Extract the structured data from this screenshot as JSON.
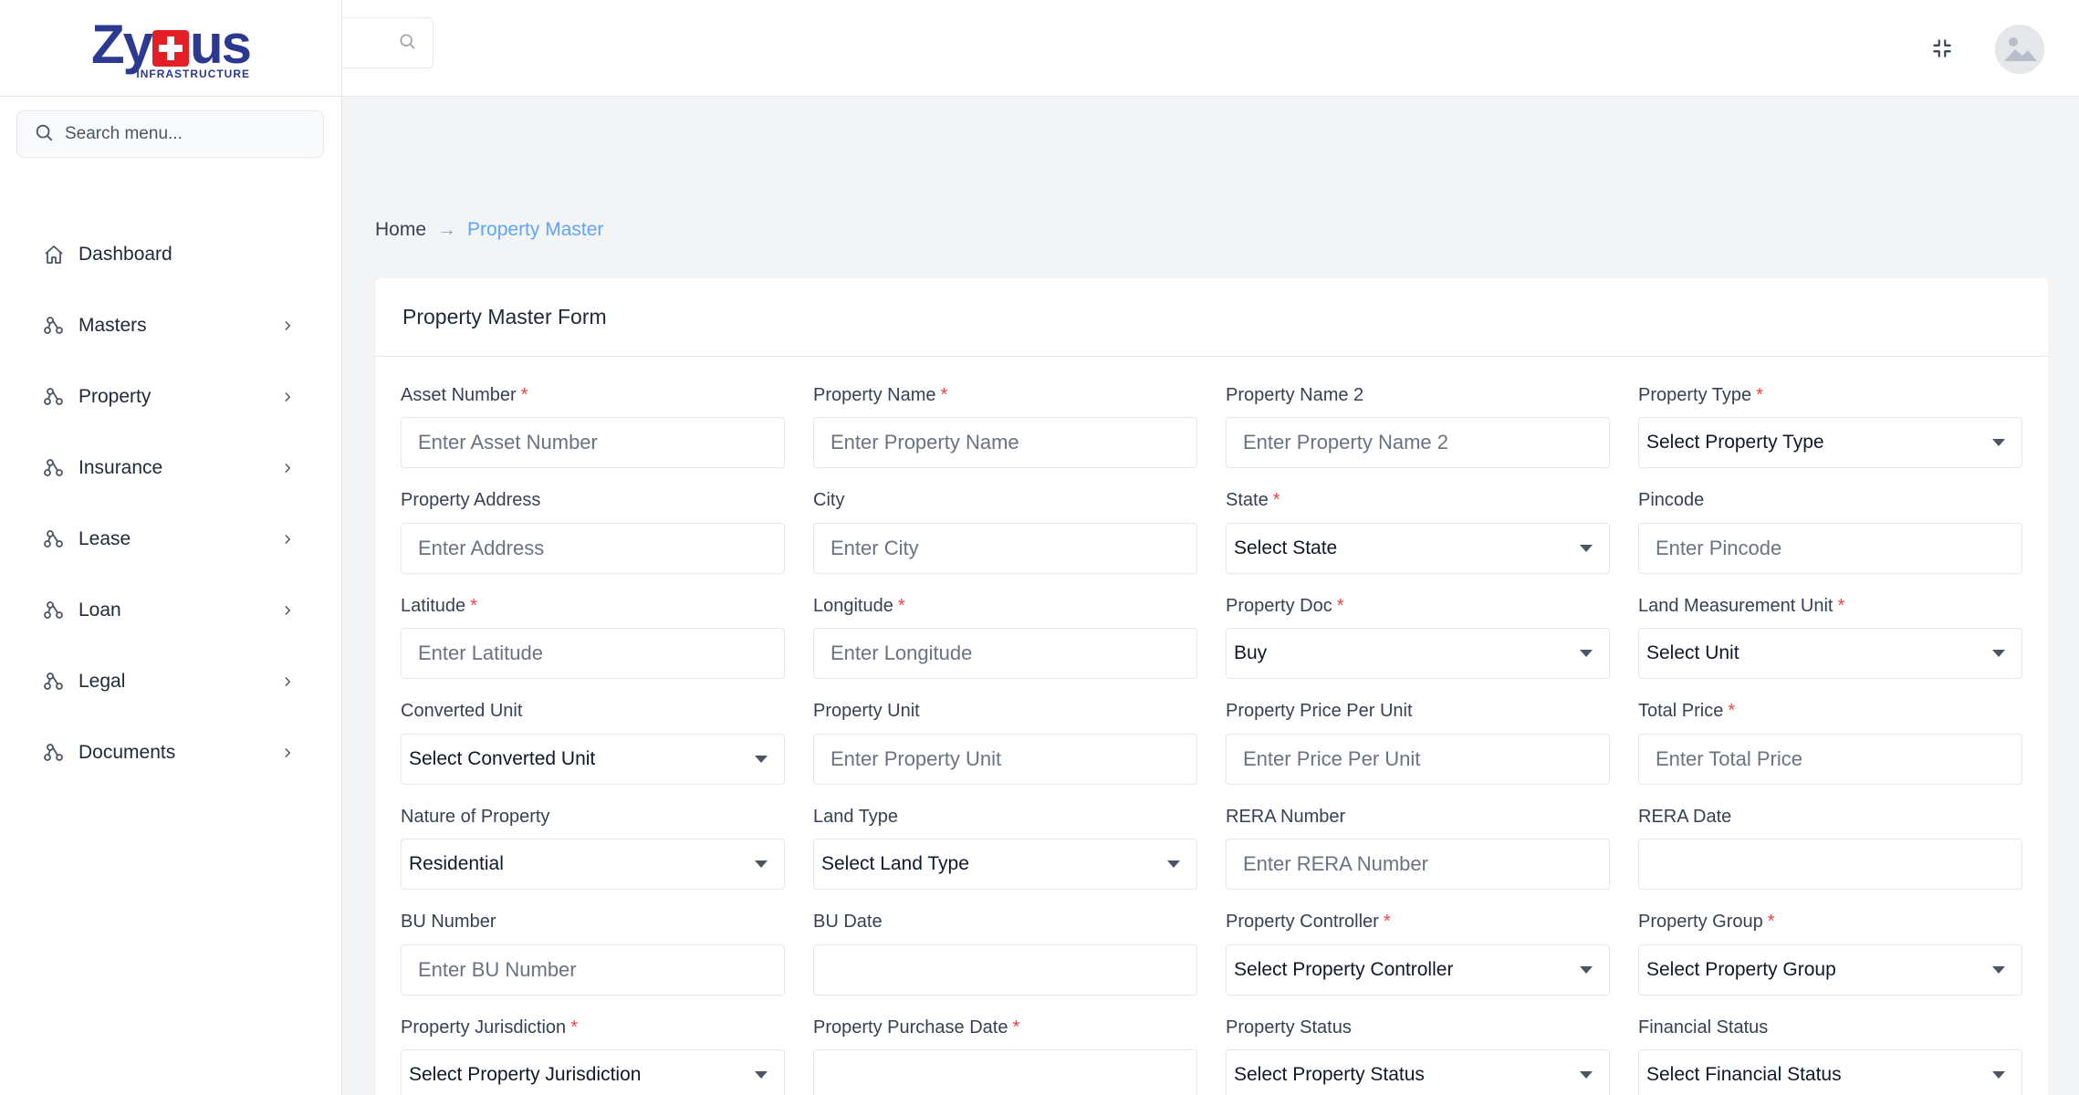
{
  "brand": {
    "name_part1": "Zy",
    "name_part2": "us",
    "subtitle": "INFRASTRUCTURE"
  },
  "sidebar": {
    "search_placeholder": "Search menu...",
    "items": [
      {
        "label": "Dashboard",
        "icon": "home-icon",
        "has_children": false
      },
      {
        "label": "Masters",
        "icon": "nodes-icon",
        "has_children": true
      },
      {
        "label": "Property",
        "icon": "nodes-icon",
        "has_children": true
      },
      {
        "label": "Insurance",
        "icon": "nodes-icon",
        "has_children": true
      },
      {
        "label": "Lease",
        "icon": "nodes-icon",
        "has_children": true
      },
      {
        "label": "Loan",
        "icon": "nodes-icon",
        "has_children": true
      },
      {
        "label": "Legal",
        "icon": "nodes-icon",
        "has_children": true
      },
      {
        "label": "Documents",
        "icon": "nodes-icon",
        "has_children": true
      }
    ]
  },
  "header": {
    "search_icon": "search-icon",
    "fullscreen_icon": "exit-fullscreen-icon",
    "avatar_icon": "avatar-placeholder-icon"
  },
  "breadcrumb": {
    "home": "Home",
    "separator": "→",
    "current": "Property Master"
  },
  "form": {
    "title": "Property Master Form",
    "fields": [
      {
        "label": "Asset Number",
        "required": true,
        "type": "input",
        "placeholder": "Enter Asset Number",
        "value": ""
      },
      {
        "label": "Property Name",
        "required": true,
        "type": "input",
        "placeholder": "Enter Property Name",
        "value": ""
      },
      {
        "label": "Property Name 2",
        "required": false,
        "type": "input",
        "placeholder": "Enter Property Name 2",
        "value": ""
      },
      {
        "label": "Property Type",
        "required": true,
        "type": "select",
        "value": "Select Property Type"
      },
      {
        "label": "Property Address",
        "required": false,
        "type": "input",
        "placeholder": "Enter Address",
        "value": ""
      },
      {
        "label": "City",
        "required": false,
        "type": "input",
        "placeholder": "Enter City",
        "value": ""
      },
      {
        "label": "State",
        "required": true,
        "type": "select",
        "value": "Select State"
      },
      {
        "label": "Pincode",
        "required": false,
        "type": "input",
        "placeholder": "Enter Pincode",
        "value": ""
      },
      {
        "label": "Latitude",
        "required": true,
        "type": "input",
        "placeholder": "Enter Latitude",
        "value": ""
      },
      {
        "label": "Longitude",
        "required": true,
        "type": "input",
        "placeholder": "Enter Longitude",
        "value": ""
      },
      {
        "label": "Property Doc",
        "required": true,
        "type": "select",
        "value": "Buy"
      },
      {
        "label": "Land Measurement Unit",
        "required": true,
        "type": "select",
        "value": "Select Unit"
      },
      {
        "label": "Converted Unit",
        "required": false,
        "type": "select",
        "value": "Select Converted Unit"
      },
      {
        "label": "Property Unit",
        "required": false,
        "type": "input",
        "placeholder": "Enter Property Unit",
        "value": ""
      },
      {
        "label": "Property Price Per Unit",
        "required": false,
        "type": "input",
        "placeholder": "Enter Price Per Unit",
        "value": ""
      },
      {
        "label": "Total Price",
        "required": true,
        "type": "input",
        "placeholder": "Enter Total Price",
        "value": ""
      },
      {
        "label": "Nature of Property",
        "required": false,
        "type": "select",
        "value": "Residential"
      },
      {
        "label": "Land Type",
        "required": false,
        "type": "select",
        "value": "Select Land Type"
      },
      {
        "label": "RERA Number",
        "required": false,
        "type": "input",
        "placeholder": "Enter RERA Number",
        "value": ""
      },
      {
        "label": "RERA Date",
        "required": false,
        "type": "input",
        "placeholder": "",
        "value": ""
      },
      {
        "label": "BU Number",
        "required": false,
        "type": "input",
        "placeholder": "Enter BU Number",
        "value": ""
      },
      {
        "label": "BU Date",
        "required": false,
        "type": "input",
        "placeholder": "",
        "value": ""
      },
      {
        "label": "Property Controller",
        "required": true,
        "type": "select",
        "value": "Select Property Controller"
      },
      {
        "label": "Property Group",
        "required": true,
        "type": "select",
        "value": "Select Property Group"
      },
      {
        "label": "Property Jurisdiction",
        "required": true,
        "type": "select",
        "value": "Select Property Jurisdiction"
      },
      {
        "label": "Property Purchase Date",
        "required": true,
        "type": "input",
        "placeholder": "",
        "value": ""
      },
      {
        "label": "Property Status",
        "required": false,
        "type": "select",
        "value": "Select Property Status"
      },
      {
        "label": "Financial Status",
        "required": false,
        "type": "select",
        "value": "Select Financial Status"
      }
    ]
  },
  "colors": {
    "brand_blue": "#2b3990",
    "brand_red": "#e31e24",
    "link_blue": "#60a5fa",
    "required_red": "#ef4444"
  }
}
